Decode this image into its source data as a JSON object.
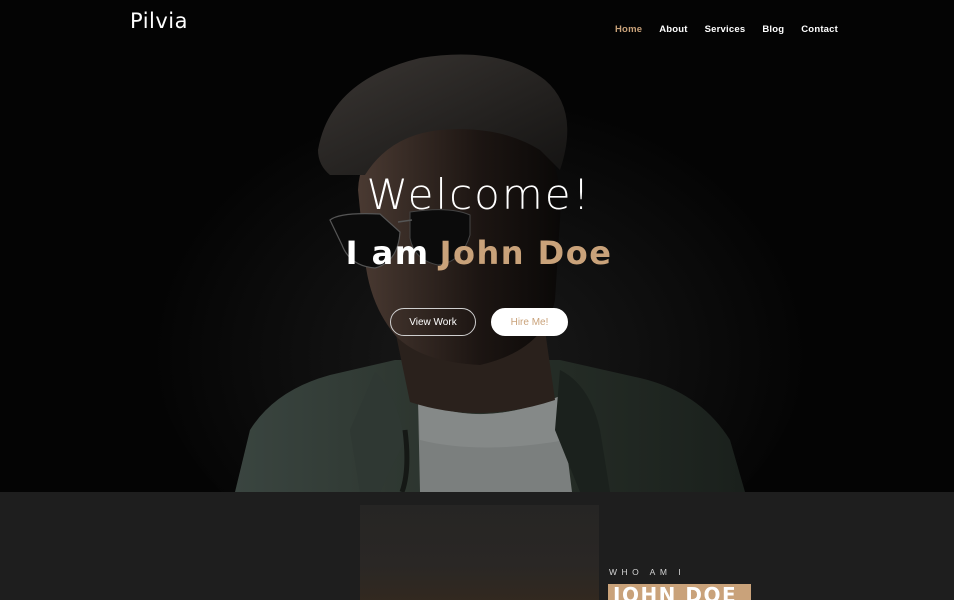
{
  "brand": {
    "name": "Pilvia"
  },
  "nav": {
    "items": [
      {
        "label": "Home",
        "active": true
      },
      {
        "label": "About",
        "active": false
      },
      {
        "label": "Services",
        "active": false
      },
      {
        "label": "Blog",
        "active": false
      },
      {
        "label": "Contact",
        "active": false
      }
    ]
  },
  "hero": {
    "welcome": "Welcome!",
    "intro": "I am",
    "name": "John Doe",
    "buttons": {
      "view_work": "View Work",
      "hire_me": "Hire Me!"
    }
  },
  "about": {
    "eyebrow": "WHO AM I",
    "name": "JOHN DOE"
  },
  "colors": {
    "accent": "#c9a27a",
    "hero_bg": "#040404",
    "about_bg": "#1e1e1e",
    "text": "#ffffff"
  }
}
